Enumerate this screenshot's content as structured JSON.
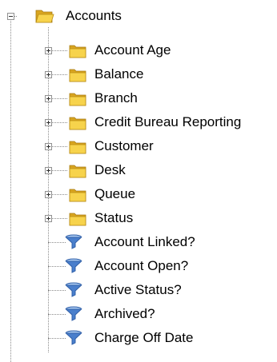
{
  "tree": {
    "root": {
      "label": "Accounts",
      "icon": "folder-open-icon",
      "expanded": true
    },
    "folders": [
      {
        "label": "Account Age",
        "icon": "folder-icon",
        "expanded": false
      },
      {
        "label": "Balance",
        "icon": "folder-icon",
        "expanded": false
      },
      {
        "label": "Branch",
        "icon": "folder-icon",
        "expanded": false
      },
      {
        "label": "Credit Bureau Reporting",
        "icon": "folder-icon",
        "expanded": false
      },
      {
        "label": "Customer",
        "icon": "folder-icon",
        "expanded": false
      },
      {
        "label": "Desk",
        "icon": "folder-icon",
        "expanded": false
      },
      {
        "label": "Queue",
        "icon": "folder-icon",
        "expanded": false
      },
      {
        "label": "Status",
        "icon": "folder-icon",
        "expanded": false
      }
    ],
    "filters": [
      {
        "label": "Account Linked?",
        "icon": "filter-icon"
      },
      {
        "label": "Account Open?",
        "icon": "filter-icon"
      },
      {
        "label": "Active Status?",
        "icon": "filter-icon"
      },
      {
        "label": "Archived?",
        "icon": "filter-icon"
      },
      {
        "label": "Charge Off Date",
        "icon": "filter-icon"
      }
    ]
  },
  "colors": {
    "folder_body": "#f7d34c",
    "folder_shade": "#d9a520",
    "filter_light": "#a8c8f0",
    "filter_dark": "#2f5fa8",
    "tree_lines": "#8c8c8c"
  }
}
